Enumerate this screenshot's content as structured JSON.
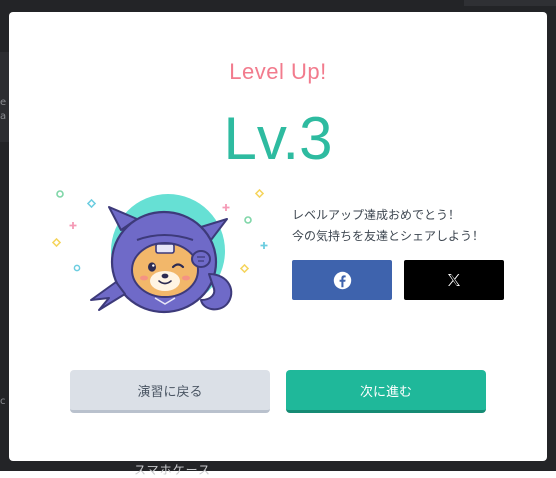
{
  "background": {
    "left_snippets": [
      "e",
      "a"
    ],
    "left_bottom_snippet": "c",
    "bottom_text": "スマホケース"
  },
  "modal": {
    "heading": "Level Up!",
    "level": "Lv.3",
    "message_line1": "レベルアップ達成おめでとう！",
    "message_line2": "今の気持ちを友達とシェアしよう！",
    "share_facebook_icon": "facebook-icon",
    "share_x_icon": "x-logo-icon",
    "back_button": "演習に戻る",
    "next_button": "次に進む"
  },
  "colors": {
    "heading": "#f27b8d",
    "level": "#2ebba0",
    "facebook": "#3e63ad",
    "x": "#000000",
    "back_button": "#dbe0e7",
    "next_button": "#1fb89a"
  }
}
